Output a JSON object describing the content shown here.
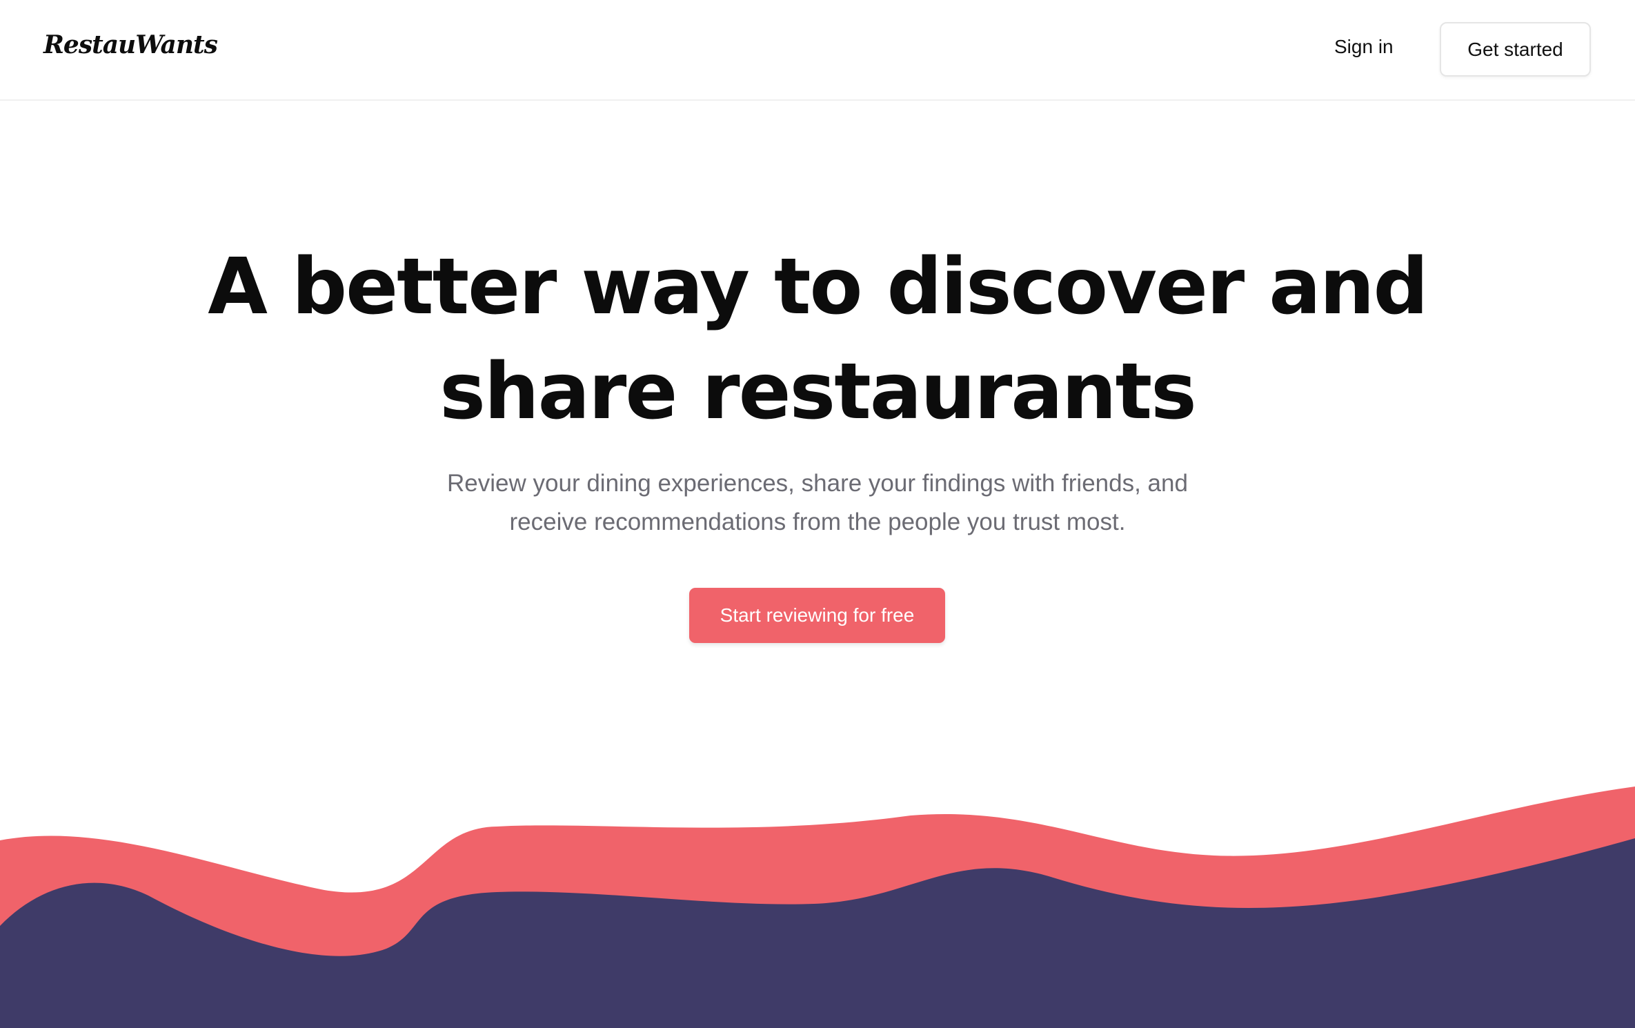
{
  "nav": {
    "logo_text": "RestauWants",
    "signin_label": "Sign in",
    "get_started_label": "Get started"
  },
  "hero": {
    "title_line1": "A better way to discover and",
    "title_line2": "share restaurants",
    "subtitle_line1": "Review your dining experiences, share your findings with friends, and",
    "subtitle_line2": "receive recommendations from the people you trust most.",
    "cta_label": "Start reviewing for free"
  },
  "colors": {
    "accent": "#f0636a",
    "wave_coral": "#f0636a",
    "wave_navy": "#3f3b68",
    "text_dark": "#0c0c0c",
    "text_muted": "#6b6b73"
  }
}
